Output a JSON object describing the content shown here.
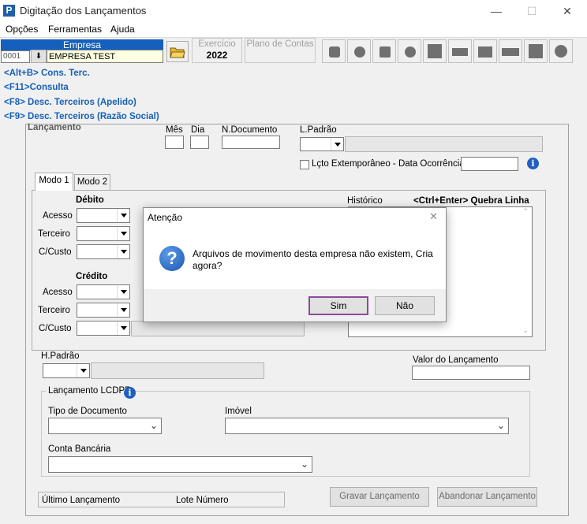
{
  "window": {
    "title": "Digitação dos Lançamentos",
    "icon_letter": "P"
  },
  "menu": [
    "Opções",
    "Ferramentas",
    "Ajuda"
  ],
  "toolbar": {
    "empresa_header": "Empresa",
    "empresa_code": "0001",
    "empresa_name": "EMPRESA TEST",
    "exercicio_label": "Exercício",
    "exercicio_value": "2022",
    "plano_label": "Plano de Contas"
  },
  "shortcuts": [
    "<Alt+B> Cons. Terc.",
    "<F11>Consulta",
    "<F8> Desc. Terceiros (Apelido)",
    "<F9> Desc. Terceiros (Razão Social)"
  ],
  "lancamento": {
    "section_label": "Lançamento",
    "mes": "Mês",
    "dia": "Dia",
    "ndoc": "N.Documento",
    "lpadrao": "L.Padrão",
    "extemporaneo": "Lçto Extemporâneo - Data Ocorrência"
  },
  "tabs": [
    "Modo 1",
    "Modo 2"
  ],
  "debito": {
    "title": "Débito",
    "acesso": "Acesso",
    "terceiro": "Terceiro",
    "ccusto": "C/Custo"
  },
  "credito": {
    "title": "Crédito",
    "acesso": "Acesso",
    "terceiro": "Terceiro",
    "ccusto": "C/Custo"
  },
  "historico": {
    "label": "Histórico",
    "hint": "<Ctrl+Enter> Quebra Linha"
  },
  "hpadrao": "H.Padrão",
  "valor_label": "Valor do Lançamento",
  "lcdpr": {
    "title": "Lançamento LCDPR",
    "tipo_doc": "Tipo de Documento",
    "imovel": "Imóvel",
    "conta": "Conta Bancária"
  },
  "footer": {
    "ultimo": "Último Lançamento",
    "lote": "Lote Número",
    "gravar": "Gravar Lançamento",
    "abandonar": "Abandonar Lançamento"
  },
  "dialog": {
    "title": "Atenção",
    "message": "Arquivos de movimento desta empresa não existem, Cria agora?",
    "yes": "Sim",
    "no": "Não"
  },
  "colors": {
    "accent": "#1560bd",
    "default_button_border": "#8b4aa0"
  }
}
